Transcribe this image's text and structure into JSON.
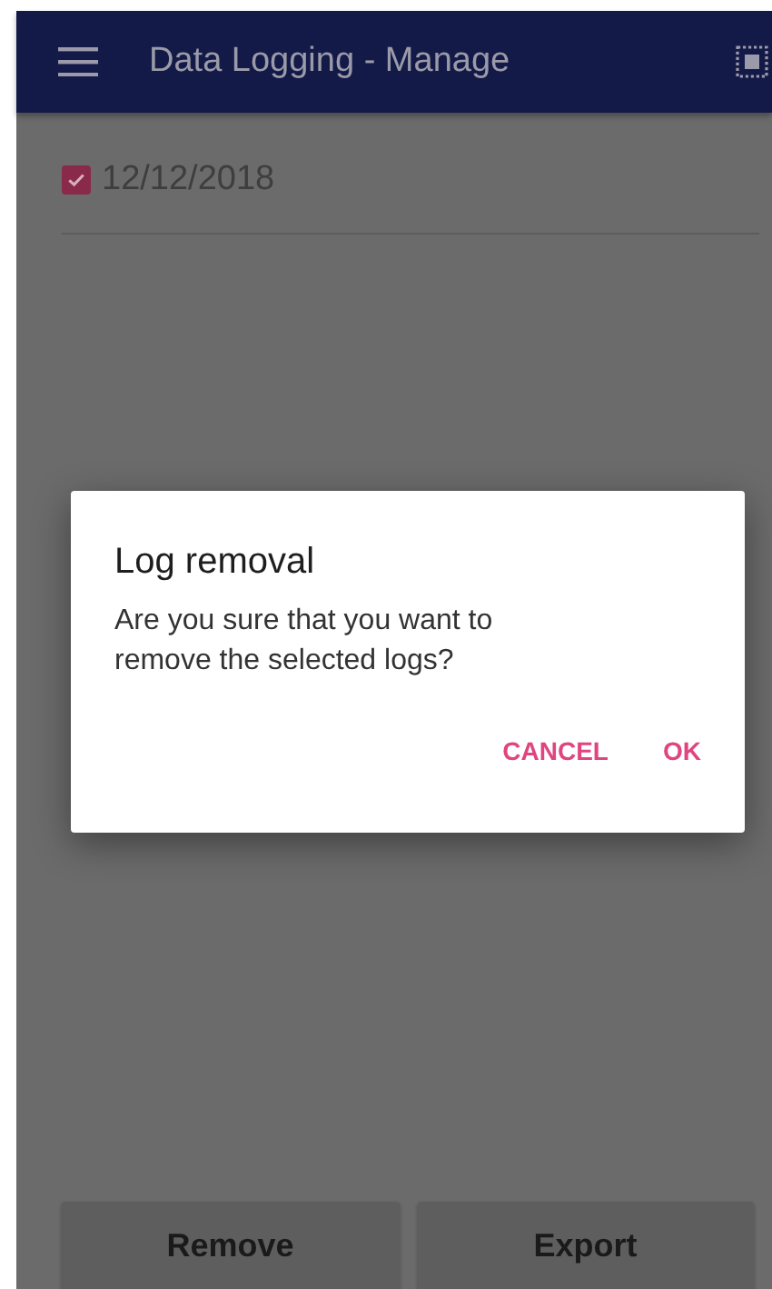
{
  "app_bar": {
    "title": "Data Logging - Manage"
  },
  "logs": [
    {
      "label": "12/12/2018",
      "checked": true
    }
  ],
  "dialog": {
    "title": "Log removal",
    "message": "Are you sure that you want to remove the selected logs?",
    "buttons": [
      "CANCEL",
      "OK"
    ]
  },
  "actions": [
    "Remove",
    "Export"
  ]
}
